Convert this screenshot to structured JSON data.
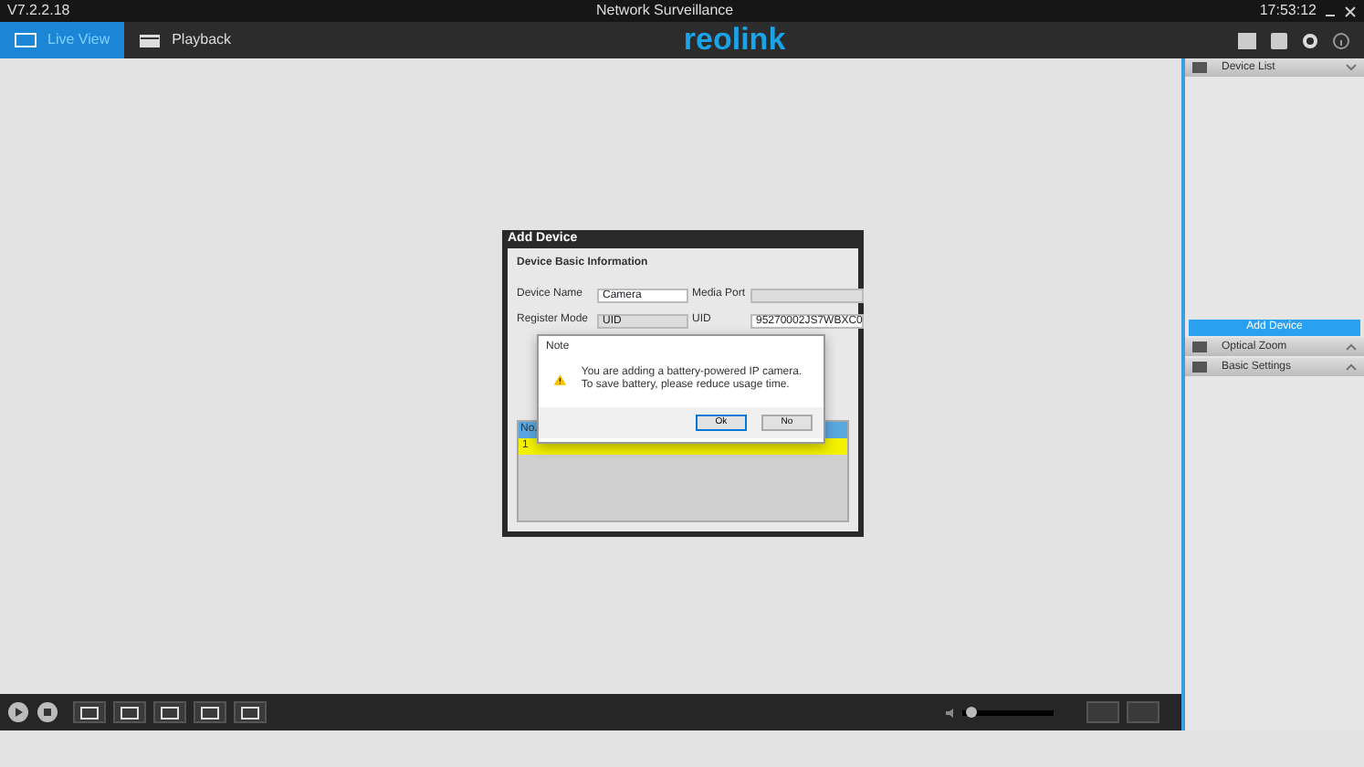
{
  "window": {
    "version": "V7.2.2.18",
    "title": "Network Surveillance",
    "time": "17:53:12"
  },
  "tabs": [
    {
      "label": "Live View",
      "selected": true
    },
    {
      "label": "Playback",
      "selected": false
    }
  ],
  "logo": "reolink",
  "side_panel": {
    "sections": [
      {
        "label": "Device List",
        "expanded": true
      },
      {
        "label": "Optical Zoom",
        "expanded": false
      },
      {
        "label": "Basic Settings",
        "expanded": false
      }
    ],
    "add_button": "Add Device"
  },
  "add_device": {
    "title": "Add Device",
    "group": "Device Basic Information",
    "fields": [
      {
        "label": "Device Name",
        "value": "Camera",
        "disabled": false
      },
      {
        "label": "Media Port",
        "disabled": true
      },
      {
        "label": "Register Mode",
        "value": "UID",
        "disabled": true
      },
      {
        "label": "UID",
        "value": "95270002JS7WBXC0",
        "disabled": false
      }
    ],
    "table": {
      "columns": [
        "No."
      ],
      "rows": [
        {
          "cells": [
            "1"
          ],
          "selected": true
        }
      ]
    }
  },
  "note": {
    "title": "Note",
    "message": "You are adding a battery-powered IP camera. To save battery, please reduce usage time.",
    "buttons": [
      {
        "label": "Ok",
        "selected": true
      },
      {
        "label": "No",
        "selected": false
      }
    ]
  },
  "volume": {
    "level": 0.05
  }
}
